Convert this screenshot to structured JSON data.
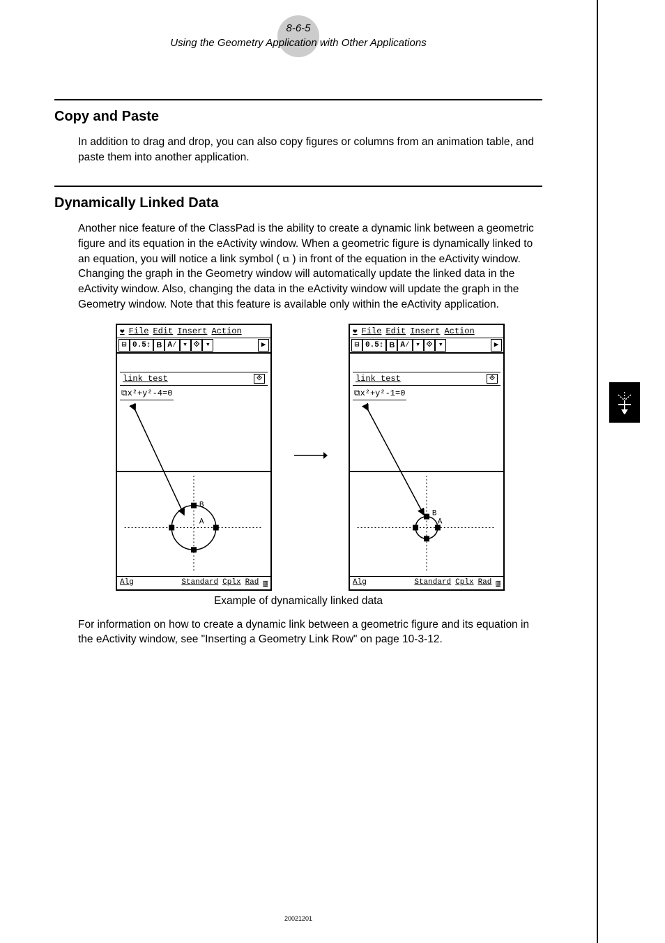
{
  "header": {
    "page_number": "8-6-5",
    "title": "Using the Geometry Application with Other Applications"
  },
  "section1": {
    "heading": "Copy and Paste",
    "para": "In addition to drag and drop, you can also copy figures or columns from an animation table, and paste them into another application."
  },
  "section2": {
    "heading": "Dynamically Linked Data",
    "para_before": "Another nice feature of the ClassPad is the ability to create a dynamic link between a geometric figure and its equation in the eActivity window. When a geometric figure is dynamically linked to an equation, you will notice a link symbol (",
    "link_glyph": "⧉",
    "para_after": ") in front of the equation in the eActivity window. Changing the graph in the Geometry window will automatically update the linked data in the eActivity window. Also, changing the data in the eActivity window will update the graph in the Geometry window. Note that this feature is available only within the eActivity application."
  },
  "calc": {
    "menu": {
      "file": "File",
      "edit": "Edit",
      "insert": "Insert",
      "action": "Action"
    },
    "toolbar": {
      "save": "⊟",
      "frac": "0.5↕",
      "bold": "B",
      "style": "A⁄",
      "geo": "⟐",
      "more": "▶"
    },
    "row_label": "link test",
    "row_icon": "⟐",
    "equation_left": "x²+y²-4=0",
    "equation_right": "x²+y²-1=0",
    "link_prefix": "⧉",
    "geom_labels": {
      "a": "A",
      "b": "B"
    },
    "status": {
      "mode": "Alg",
      "std": "Standard",
      "cplx": "Cplx",
      "rad": "Rad",
      "bat": "▥"
    }
  },
  "caption": "Example of dynamically linked data",
  "footnote": "For information on how to create a dynamic link between a geometric figure and its equation in the eActivity window, see \"Inserting a Geometry Link Row\" on page 10-3-12.",
  "footer_code": "20021201"
}
